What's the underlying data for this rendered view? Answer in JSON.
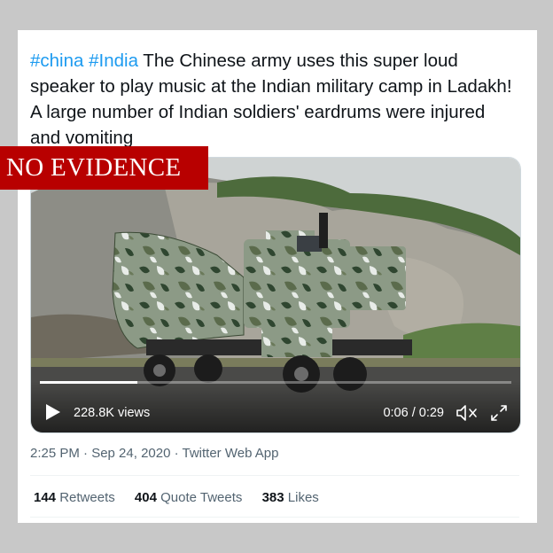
{
  "tweet": {
    "hashtag1": "#china",
    "hashtag2": "#India",
    "text": " The Chinese army uses this super loud speaker to play music at the Indian military camp in Ladakh! A large number of Indian soldiers' eardrums were injured and vomiting"
  },
  "badge": {
    "label": "NO EVIDENCE"
  },
  "video": {
    "views": "228.8K views",
    "time": "0:06 / 0:29",
    "progress": 0.207
  },
  "meta": {
    "timestamp": "2:25 PM · Sep 24, 2020 · Twitter Web App"
  },
  "stats": {
    "retweets_count": "144",
    "retweets_label": "Retweets",
    "quotes_count": "404",
    "quotes_label": "Quote Tweets",
    "likes_count": "383",
    "likes_label": "Likes"
  },
  "colors": {
    "link": "#1d9bf0",
    "badge": "#b80000",
    "text": "#0f1419",
    "muted": "#536471"
  },
  "icons": [
    "play-icon",
    "mute-icon",
    "fullscreen-icon"
  ]
}
